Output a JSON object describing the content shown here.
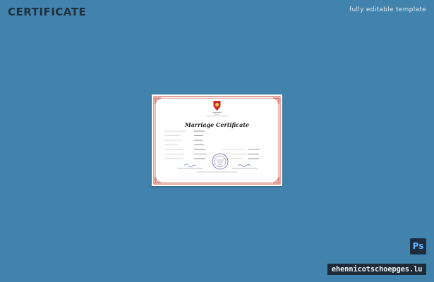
{
  "header": {
    "title": "CERTIFICATE",
    "tagline": "fully editable template"
  },
  "certificate": {
    "heading": "Marriage Certificate",
    "org_lines": [
      "",
      "",
      ""
    ],
    "fields_left": [
      {
        "label": "",
        "value": ""
      },
      {
        "label": "",
        "value": ""
      },
      {
        "label": "",
        "value": ""
      },
      {
        "label": "",
        "value": ""
      },
      {
        "label": "",
        "value": ""
      },
      {
        "label": "",
        "value": ""
      },
      {
        "label": "",
        "value": ""
      }
    ],
    "signature_captions": [
      "",
      ""
    ],
    "footer_line": ""
  },
  "badge": {
    "ps_label": "Ps"
  },
  "watermark": {
    "text": "ehennicotschoepges.lu"
  },
  "colors": {
    "background": "#4283ad",
    "border_red": "#c0392b",
    "stamp_purple": "#6b5aa8",
    "seal_red": "#c62828",
    "seal_gold": "#f2c14e"
  }
}
